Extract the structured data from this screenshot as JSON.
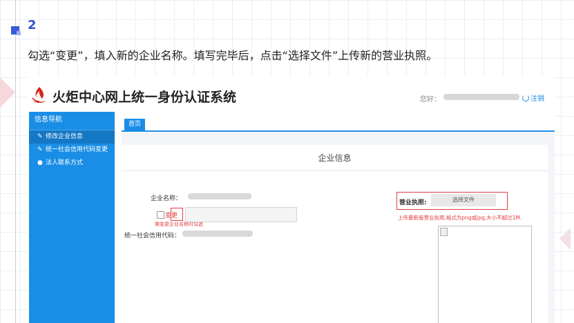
{
  "slide": {
    "step_number": "2",
    "instruction": "勾选“变更”，填入新的企业名称。填写完毕后，点击“选择文件”上传新的营业执照。"
  },
  "app": {
    "title": "火炬中心网上统一身份认证系统",
    "greeting_label": "您好：",
    "logout_label": "注销",
    "logo_icon": "torch-logo-icon"
  },
  "sidebar": {
    "header": "信息导航",
    "items": [
      {
        "icon": "edit-icon",
        "label": "修改企业信息",
        "active": true
      },
      {
        "icon": "edit-icon",
        "label": "统一社会信用代码变更",
        "active": false
      },
      {
        "icon": "user-icon",
        "label": "法人联系方式",
        "active": false
      }
    ]
  },
  "tabs": {
    "home": "首页"
  },
  "form": {
    "title": "企业信息",
    "company_name_label": "企业名称：",
    "change_label": "变更",
    "change_hint": "需变更企业名称时勾选",
    "credit_code_label": "统一社会信用代码：",
    "license_label": "营业执照:",
    "choose_file_label": "选择文件",
    "license_hint": "上传最新版营业执照,格式为png或jpg,大小不超过1M."
  },
  "colors": {
    "accent": "#1a8ee6",
    "highlight": "#e23c3c",
    "step": "#2f54c9"
  }
}
